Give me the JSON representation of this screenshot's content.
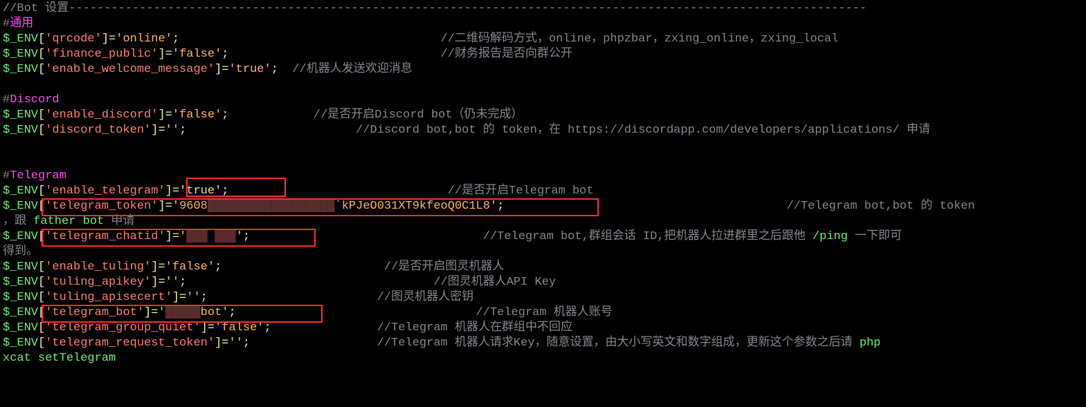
{
  "header": {
    "title": "//Bot 设置",
    "dashes": "-----------------------------------------------------------------------------------------------------------------"
  },
  "sections": {
    "general": {
      "label": "通用",
      "qrcode": {
        "key": "qrcode",
        "val": "online",
        "comment": "//二维码解码方式，online，phpzbar，zxing_online，zxing_local"
      },
      "finance": {
        "key": "finance_public",
        "val": "false",
        "comment": "//财务报告是否向群公开"
      },
      "welcome": {
        "key": "enable_welcome_message",
        "val": "true",
        "comment": "//机器人发送欢迎消息"
      }
    },
    "discord": {
      "label": "Discord",
      "enable": {
        "key": "enable_discord",
        "val": "false",
        "comment1": "//是否开启Discord bot",
        "comment2": "（仍未完成）"
      },
      "token": {
        "key": "discord_token",
        "val": "",
        "comment": "//Discord bot,bot 的 token，在 https://discordapp.com/developers/applications/ 申请"
      }
    },
    "telegram": {
      "label": "Telegram",
      "enable": {
        "key": "enable_telegram",
        "val": "true",
        "comment": "//是否开启Telegram bot"
      },
      "token": {
        "key": "telegram_token",
        "val_a": "9608",
        "val_b": "kPJeO031XT9kfeoQ0C1L8",
        "comment": "//Telegram bot,bot 的 token"
      },
      "token_sub": {
        "prefix": "，跟",
        "link": "father bot",
        "suffix": " 申请"
      },
      "chatid": {
        "key": "telegram_chatid",
        "comment": "//Telegram bot,群组会话 ID,把机器人拉进群里之后跟他 ",
        "ping": "/ping",
        "tail": " 一下即可"
      },
      "chatid_sub": "得到。",
      "tuling_en": {
        "key": "enable_tuling",
        "val": "false",
        "comment": "//是否开启图灵机器人"
      },
      "tuling_key": {
        "key": "tuling_apikey",
        "val": "",
        "comment": "//图灵机器人API Key"
      },
      "tuling_sec": {
        "key": "tuling_apisecert",
        "val": "",
        "comment": "//图灵机器人密钥"
      },
      "bot": {
        "key": "telegram_bot",
        "val": "bot",
        "comment": "//Telegram 机器人账号"
      },
      "quiet": {
        "key": "telegram_group_quiet",
        "val": "false",
        "comment": "//Telegram 机器人在群组中不回应"
      },
      "req": {
        "key": "telegram_request_token",
        "val": "",
        "comment": "//Telegram 机器人请求Key，随意设置，由大小写英文和数字组成，更新这个参数之后请 ",
        "php": "php"
      },
      "req_sub": "xcat setTelegram"
    }
  }
}
